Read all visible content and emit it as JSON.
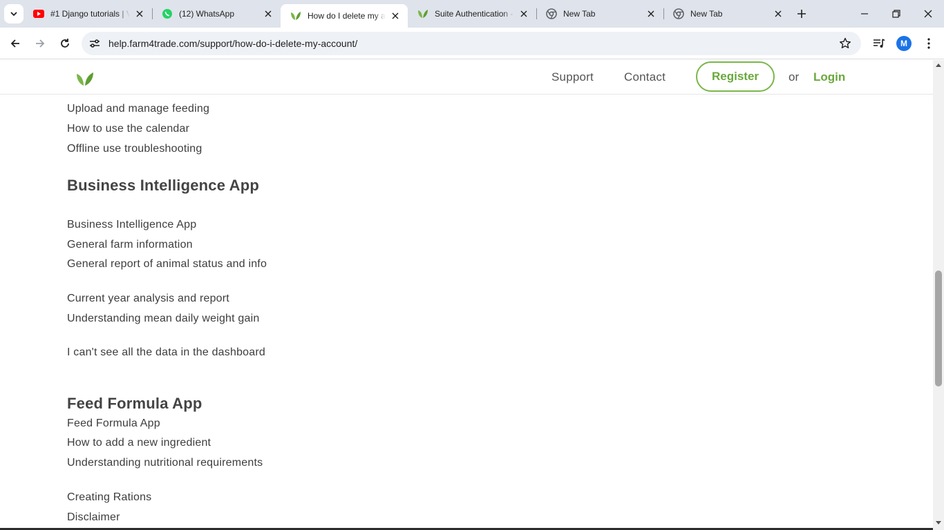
{
  "browser": {
    "tabs": [
      {
        "title": "#1 Django tutorials | V",
        "icon": "youtube-icon",
        "active": false
      },
      {
        "title": "(12) WhatsApp",
        "icon": "whatsapp-icon",
        "active": false
      },
      {
        "title": "How do I delete my a",
        "icon": "farm4trade-leaf-icon",
        "active": true
      },
      {
        "title": "Suite Authentication -",
        "icon": "farm4trade-leaf-icon",
        "active": false
      },
      {
        "title": "New Tab",
        "icon": "chrome-icon",
        "active": false
      },
      {
        "title": "New Tab",
        "icon": "chrome-icon",
        "active": false
      }
    ],
    "url": "help.farm4trade.com/support/how-do-i-delete-my-account/",
    "profile_initial": "M"
  },
  "site": {
    "nav": {
      "support": "Support",
      "contact": "Contact",
      "register": "Register",
      "or": "or",
      "login": "Login"
    },
    "brand_color": "#7ab648"
  },
  "sidebar": {
    "top_links": [
      "Upload and manage feeding",
      "How to use the calendar",
      "Offline use troubleshooting"
    ],
    "sections": [
      {
        "heading": "Business Intelligence App",
        "links": [
          "Business Intelligence App",
          "General farm information",
          "General report of animal status and info",
          "Current year analysis and report",
          "Understanding mean daily weight gain",
          "I can't see all the data in the dashboard"
        ]
      },
      {
        "heading": "Feed Formula App",
        "links": [
          "Feed Formula App",
          "How to add a new ingredient",
          "Understanding nutritional requirements",
          "Creating Rations",
          "Disclaimer"
        ]
      }
    ]
  }
}
